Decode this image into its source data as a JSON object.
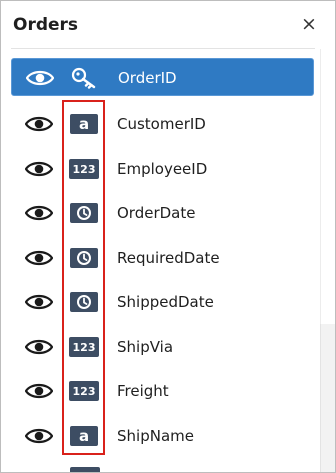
{
  "panel": {
    "title": "Orders",
    "close_label": "×"
  },
  "fields": [
    {
      "label": "OrderID",
      "type": "key",
      "icon": "key-icon",
      "selected": true
    },
    {
      "label": "CustomerID",
      "type": "text",
      "type_glyph": "a",
      "icon": "string-type-icon",
      "selected": false
    },
    {
      "label": "EmployeeID",
      "type": "number",
      "type_glyph": "123",
      "icon": "number-type-icon",
      "selected": false
    },
    {
      "label": "OrderDate",
      "type": "date",
      "icon": "date-type-icon",
      "selected": false
    },
    {
      "label": "RequiredDate",
      "type": "date",
      "icon": "date-type-icon",
      "selected": false
    },
    {
      "label": "ShippedDate",
      "type": "date",
      "icon": "date-type-icon",
      "selected": false
    },
    {
      "label": "ShipVia",
      "type": "number",
      "type_glyph": "123",
      "icon": "number-type-icon",
      "selected": false
    },
    {
      "label": "Freight",
      "type": "number",
      "type_glyph": "123",
      "icon": "number-type-icon",
      "selected": false
    },
    {
      "label": "ShipName",
      "type": "text",
      "type_glyph": "a",
      "icon": "string-type-icon",
      "selected": false
    }
  ],
  "colors": {
    "selected_row": "#2f7ac3",
    "type_icon_bg": "#3d4d63",
    "highlight_border": "#d9211b"
  }
}
